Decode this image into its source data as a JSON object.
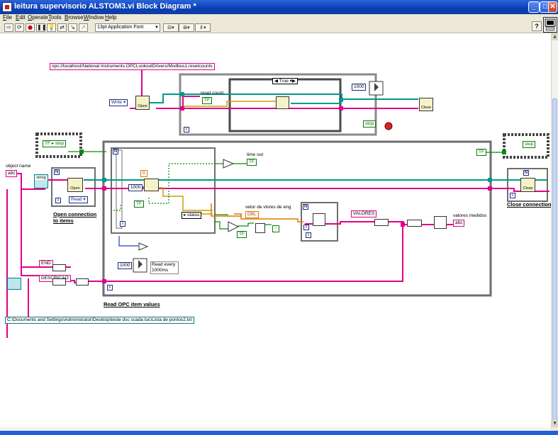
{
  "window": {
    "title": "leitura supervisorio ALSTOM3.vi Block Diagram *",
    "controls": [
      "_",
      "□",
      "✕"
    ]
  },
  "menu": [
    "File",
    "Edit",
    "Operate",
    "Tools",
    "Browse",
    "Window",
    "Help"
  ],
  "toolbar": {
    "font": "13pt Application Font",
    "help_label": "?"
  },
  "diagram": {
    "opc_url": "opc://localhost/National Instruments.OPCLookoutDrivers/Modbus1.resetcounts",
    "write_mode": "Write",
    "open_label": "Open",
    "close_label": "Close",
    "case_selector": "True",
    "reset_count_label": "reset count",
    "tf": "TF",
    "delay_ms_top": "1000",
    "stop_label": "stop",
    "object_name_label": "object name",
    "abc": "abc",
    "string_label": "string",
    "read_mode": "Read",
    "open_connection_label": "Open connection to items",
    "zero_const": "0",
    "delay_ms_inner": "1000",
    "time_out_label": "time out",
    "status_label": "status",
    "vetor_label": "vetor de vlores de eng",
    "dbl": "DBL",
    "valores_const": "VALORES",
    "valores_medidos_label": "valores medidos",
    "read_every_label": "Read every 1000ms",
    "read_delay_ms": "1000",
    "end_const": "END",
    "descricao_const": "DESCRICAO",
    "read_opc_label": "Read OPC item values",
    "close_connections_label": "Close connections",
    "file_path": "C:\\Documents and Settings\\Administrator\\Desktop\\teste dsc scada tuc\\Lista de pontos2.txt",
    "loop_n": "N",
    "loop_i": "i"
  },
  "colors": {
    "string_wire": "#e0008a",
    "refnum_wire": "#009a8a",
    "error_wire": "#c8a000",
    "bool_wire": "#0a8a0a",
    "numeric_wire": "#1d3fbf",
    "titlebar": "#0a3fb4"
  }
}
